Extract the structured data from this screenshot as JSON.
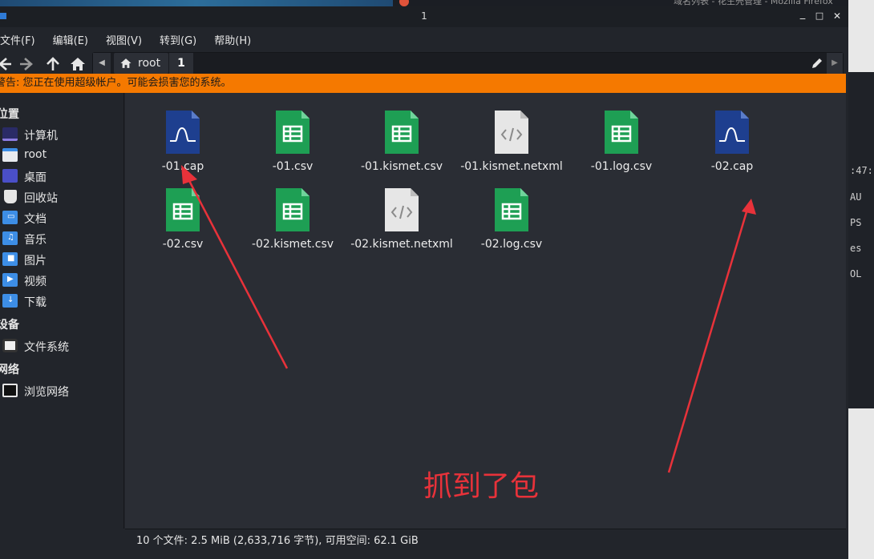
{
  "background": {
    "other_window_title": "域名列表 - 花生壳管理 - Mozilla Firefox",
    "terminal_lines": [
      ":47:",
      "AU",
      "PS",
      "es",
      "OL"
    ]
  },
  "window": {
    "title": "1",
    "controls": {
      "minimize": "_",
      "maximize": "□",
      "close": "✕"
    }
  },
  "menu": {
    "items": [
      "文件(F)",
      "编辑(E)",
      "视图(V)",
      "转到(G)",
      "帮助(H)"
    ]
  },
  "path": {
    "root_label": "root",
    "current_label": "1"
  },
  "warning": {
    "text": "警告: 您正在使用超级帐户。可能会损害您的系统。",
    "color": "#f57900"
  },
  "sidebar": {
    "places_heading": "位置",
    "places": [
      {
        "label": "计算机",
        "icon": "computer-icon"
      },
      {
        "label": "root",
        "icon": "home-folder-icon"
      },
      {
        "label": "桌面",
        "icon": "desktop-icon"
      },
      {
        "label": "回收站",
        "icon": "trash-icon"
      },
      {
        "label": "文档",
        "icon": "documents-folder-icon"
      },
      {
        "label": "音乐",
        "icon": "music-folder-icon"
      },
      {
        "label": "图片",
        "icon": "pictures-folder-icon"
      },
      {
        "label": "视频",
        "icon": "videos-folder-icon"
      },
      {
        "label": "下载",
        "icon": "downloads-folder-icon"
      }
    ],
    "devices_heading": "设备",
    "devices": [
      {
        "label": "文件系统",
        "icon": "drive-icon"
      }
    ],
    "network_heading": "网络",
    "network": [
      {
        "label": "浏览网络",
        "icon": "network-icon"
      }
    ]
  },
  "files": [
    {
      "name": "-01.cap",
      "type": "cap"
    },
    {
      "name": "-01.csv",
      "type": "csv"
    },
    {
      "name": "-01.kismet.csv",
      "type": "csv"
    },
    {
      "name": "-01.kismet.netxml",
      "type": "xml"
    },
    {
      "name": "-01.log.csv",
      "type": "csv"
    },
    {
      "name": "-02.cap",
      "type": "cap"
    },
    {
      "name": "-02.csv",
      "type": "csv"
    },
    {
      "name": "-02.kismet.csv",
      "type": "csv"
    },
    {
      "name": "-02.kismet.netxml",
      "type": "xml"
    },
    {
      "name": "-02.log.csv",
      "type": "csv"
    }
  ],
  "status": {
    "text": "10 个文件: 2.5 MiB (2,633,716 字节), 可用空间: 62.1 GiB"
  },
  "annotation": {
    "text": "抓到了包",
    "color": "#e8323a"
  }
}
